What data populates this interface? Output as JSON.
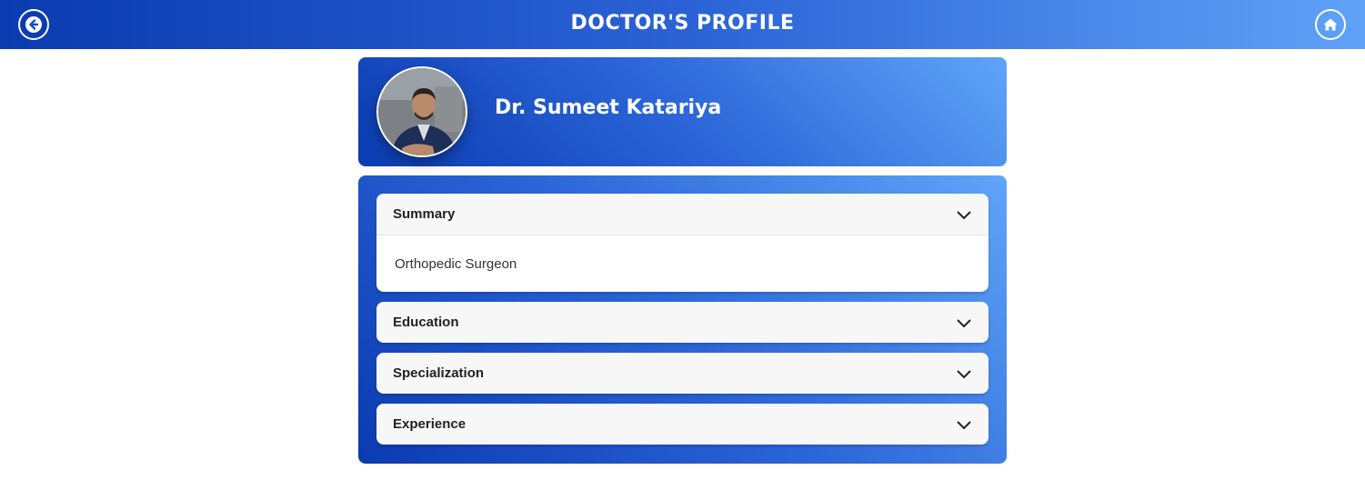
{
  "header": {
    "title": "DOCTOR'S PROFILE",
    "back_icon": "arrow-left-icon",
    "home_icon": "home-icon",
    "gradient_start": "#0a3bb0",
    "gradient_end": "#5fa2f7"
  },
  "profile": {
    "name": "Dr. Sumeet Katariya",
    "avatar": "doctor-photo"
  },
  "accordion": [
    {
      "label": "Summary",
      "expanded": true,
      "content": "Orthopedic Surgeon"
    },
    {
      "label": "Education",
      "expanded": false
    },
    {
      "label": "Specialization",
      "expanded": false
    },
    {
      "label": "Experience",
      "expanded": false
    }
  ]
}
